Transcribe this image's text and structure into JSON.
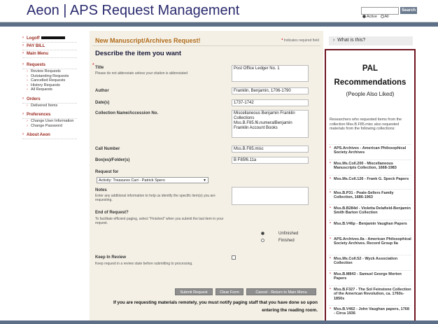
{
  "header": {
    "title": "Aeon | APS Request Management",
    "search_button": "Search",
    "search_value": "",
    "radio_active": "Active",
    "radio_all": "All"
  },
  "sidebar": {
    "logoff": "Logoff",
    "pay_bill": "PAY BILL",
    "main_menu": "Main Menu",
    "requests": {
      "label": "Requests",
      "items": [
        "Review Requests",
        "Outstanding Requests",
        "Cancelled Requests",
        "History Requests",
        "All Requests"
      ]
    },
    "orders": {
      "label": "Orders",
      "items": [
        "Delivered Items"
      ]
    },
    "preferences": {
      "label": "Preferences",
      "items": [
        "Change User Information",
        "Change Password"
      ]
    },
    "about": "About Aeon"
  },
  "form": {
    "title": "New Manuscript/Archives Request!",
    "required_note_star": "*",
    "required_note": "Indicates required field",
    "heading": "Describe the item you want",
    "fields": {
      "title": {
        "label": "Title",
        "star": "*",
        "help": "Please do not abbreviate unless your citation is abbreviated",
        "value": "Post Office Ledger No. 1"
      },
      "author": {
        "label": "Author",
        "value": "Franklin, Benjamin, 1706-1790"
      },
      "dates": {
        "label": "Date(s)",
        "value": "1737-1742"
      },
      "collection": {
        "label": "Collection Name/Accession No.",
        "value": "Miscellaneous Benjamin Franklin\nCollections\nMss.B.F85.f6.numeralBenjamin\nFranklin Account Books"
      },
      "call_number": {
        "label": "Call Number",
        "value": "Mss.B.F85.misc"
      },
      "box_folder": {
        "label": "Box(es)/Folder(s)",
        "value": "B F85f6.11a"
      },
      "request_for": {
        "label": "Request for",
        "value": "Activity: Treasures Cart - Patrick Spero"
      },
      "notes": {
        "label": "Notes",
        "help": "Enter any additional information to help us identify the specific item(s) you are requesting.",
        "value": ""
      },
      "end_of_request": {
        "label": "End of Request?",
        "help": "To facilitate efficient paging, select \"Finished\" when you submit the last item in your request.",
        "option_unfinished": "Unfinished",
        "option_finished": "Finished",
        "selected": "Unfinished"
      },
      "keep_in_review": {
        "label": "Keep In Review",
        "help": "Keep request in a review state before submitting to processing.",
        "checked": false
      }
    },
    "remote_note": "If you are requesting materials remotely, you must notify paging staff that you have done so upon entering the reading room.",
    "buttons": {
      "submit": "Submit Request",
      "clear": "Clear Form",
      "cancel": "Cancel - Return to Main Menu"
    }
  },
  "right": {
    "what_is_this": "What is this?",
    "pal_title": "PAL Recommendations",
    "pal_subtitle": "(People Also Liked)",
    "pal_intro": "Researchers who requested items from the collection Mss.B.F85.misc also requested materials from the following collections:",
    "pal_items": [
      "APS.Archives - American Philosophical Society Archives",
      "Mss.Ms.Coll.200 - Miscellaneous Manuscripts Collection, 1668-1983",
      "Mss.Ms.Coll.126 - Frank G. Speck Papers",
      "Mss.B.P31 - Peale-Sellers Family Collection, 1686-1963",
      "Mss.B.B284d - Violetta Delafield-Benjamin Smith Barton Collection",
      "Mss.B.V46p - Benjamin Vaughan Papers",
      "APS.Archives.IIa - American Philosophical Society Archives. Record Group IIa",
      "Mss.Ms.Coll.52 - Wyck Association Collection",
      "Mss.B.M843 - Samuel George Morton Papers",
      "Mss.B.F327 - The Sol Feinstone Collection of the American Revolution, ca. 1760s-1850s",
      "Mss.B.V462 - John Vaughan papers, 1768 - Circa 1936"
    ]
  }
}
